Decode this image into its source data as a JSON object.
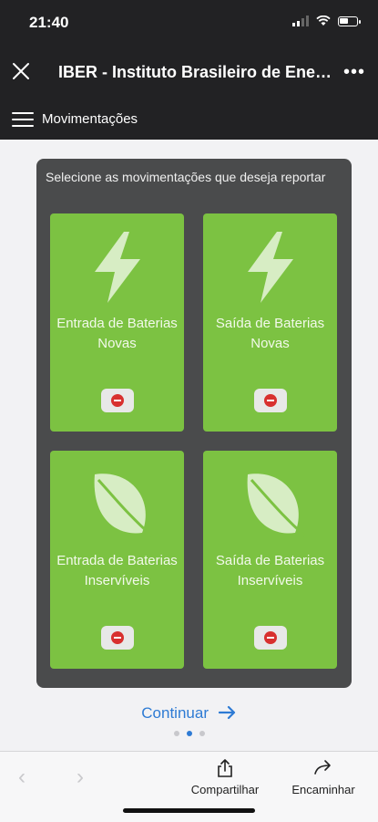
{
  "status": {
    "time": "21:40"
  },
  "header": {
    "title": "IBER - Instituto Brasileiro de Energia Reciclável",
    "close_icon": "close-icon",
    "more_icon": "more-icon"
  },
  "nav": {
    "label": "Movimentações",
    "menu_icon": "hamburger-menu-icon"
  },
  "panel": {
    "prompt": "Selecione as movimentações que deseja reportar",
    "tiles": [
      {
        "icon": "lightning-icon",
        "label": "Entrada de Baterias Novas"
      },
      {
        "icon": "lightning-icon",
        "label": "Saída de Baterias Novas"
      },
      {
        "icon": "leaf-icon",
        "label": "Entrada de Baterias Inservíveis"
      },
      {
        "icon": "leaf-icon",
        "label": "Saída de Baterias Inservíveis"
      }
    ]
  },
  "continue_label": "Continuar",
  "pager": {
    "count": 3,
    "active": 2
  },
  "bottom": {
    "share_label": "Compartilhar",
    "forward_label": "Encaminhar"
  },
  "colors": {
    "tile_green": "#7cc242",
    "panel_gray": "#4a4b4c",
    "accent_blue": "#2e7bd4",
    "remove_red": "#d8302f"
  }
}
